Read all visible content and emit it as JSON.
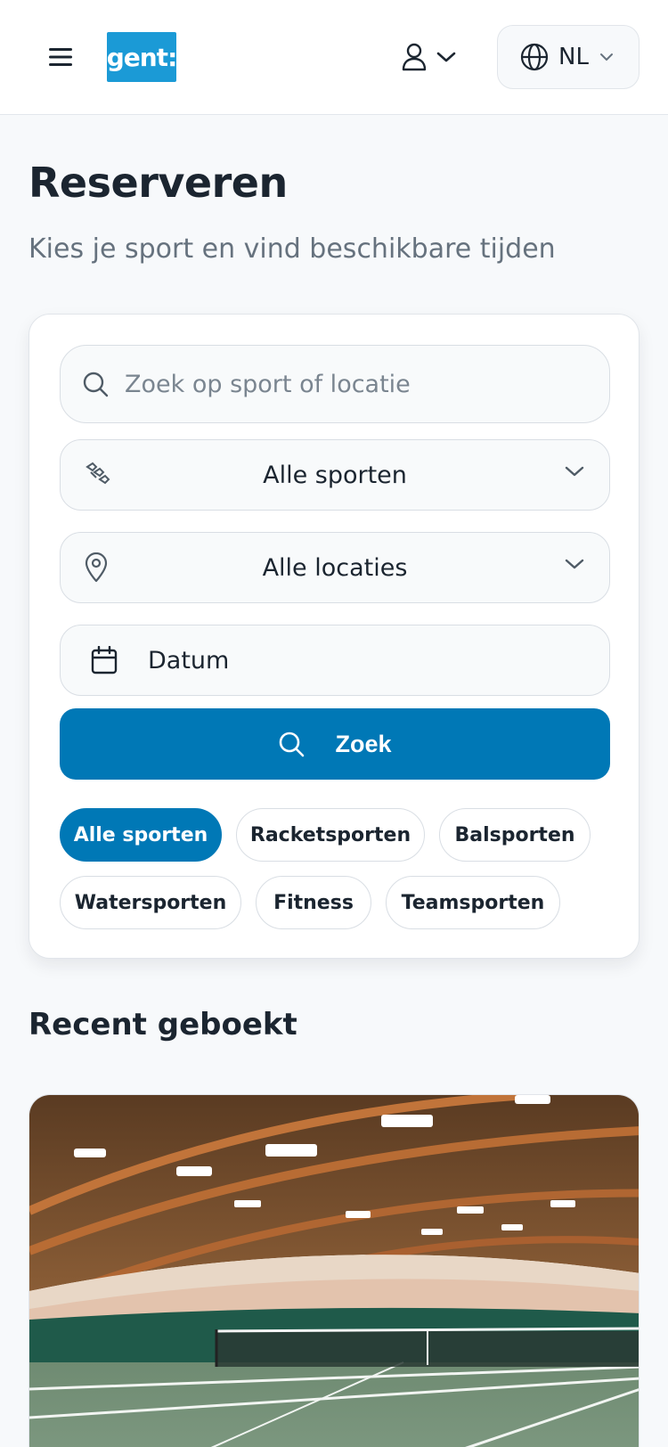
{
  "header": {
    "logo_text": "gent:",
    "language_code": "NL"
  },
  "page": {
    "title": "Reserveren",
    "subtitle": "Kies je sport en vind beschikbare tijden"
  },
  "search": {
    "placeholder": "Zoek op sport of locatie",
    "sport_select": "Alle sporten",
    "location_select": "Alle locaties",
    "date_label": "Datum",
    "button_label": "Zoek"
  },
  "filters": [
    {
      "label": "Alle sporten",
      "active": true
    },
    {
      "label": "Racketsporten",
      "active": false
    },
    {
      "label": "Balsporten",
      "active": false
    },
    {
      "label": "Watersporten",
      "active": false
    },
    {
      "label": "Fitness",
      "active": false
    },
    {
      "label": "Teamsporten",
      "active": false
    }
  ],
  "recent": {
    "title": "Recent geboekt",
    "image_description_icon": "indoor-tennis-court-image"
  },
  "colors": {
    "primary": "#0078b6",
    "logo_bg": "#1b9ad6",
    "text": "#1b2530",
    "muted": "#66727e"
  }
}
